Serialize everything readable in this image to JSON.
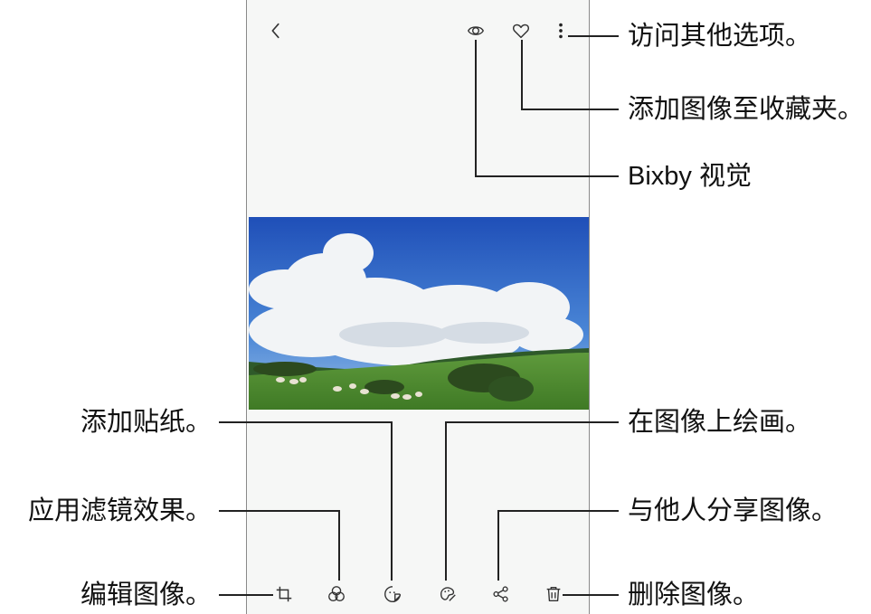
{
  "toolbar_top": {
    "back_icon": "chevron-left",
    "bixby_icon": "bixby-vision-eye",
    "favorite_icon": "heart-outline",
    "more_icon": "more-vertical"
  },
  "toolbar_bottom": {
    "edit_icon": "crop-rotate",
    "filter_icon": "filter-circles",
    "sticker_icon": "sticker-smiley",
    "draw_icon": "palette-brush",
    "share_icon": "share",
    "delete_icon": "trash"
  },
  "callouts": {
    "more_options": "访问其他选项。",
    "add_favorite": "添加图像至收藏夹。",
    "bixby_vision": "Bixby 视觉",
    "draw_on_image": "在图像上绘画。",
    "share_image": "与他人分享图像。",
    "delete_image": "删除图像。",
    "add_sticker": "添加贴纸。",
    "apply_filter": "应用滤镜效果。",
    "edit_image": "编辑图像。"
  }
}
